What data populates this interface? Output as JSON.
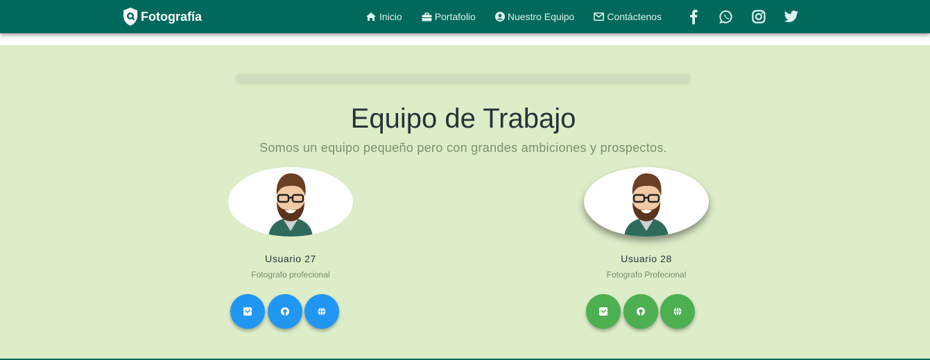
{
  "navbar": {
    "brand": "Fotografía",
    "links": [
      {
        "label": "Inicio",
        "icon": "home-icon"
      },
      {
        "label": "Portafolio",
        "icon": "briefcase-icon"
      },
      {
        "label": "Nuestro Equipo",
        "icon": "user-circle-icon"
      },
      {
        "label": "Contáctenos",
        "icon": "envelope-icon"
      }
    ],
    "social": [
      "facebook-icon",
      "whatsapp-icon",
      "instagram-icon",
      "twitter-icon"
    ],
    "color": "#00695c"
  },
  "team": {
    "title": "Equipo de Trabajo",
    "subtitle": "Somos un equipo pequeño pero con grandes ambiciones y prospectos.",
    "background": "#dcedc8",
    "members": [
      {
        "name": "Usuario 27",
        "role": "Fotografo profecional",
        "button_color": "#2196f3",
        "buttons": [
          "twitter-square-icon",
          "github-icon",
          "globe-icon"
        ]
      },
      {
        "name": "Usuario 28",
        "role": "Fotografo Profecional",
        "button_color": "#4caf50",
        "buttons": [
          "twitter-square-icon",
          "github-icon",
          "globe-icon"
        ]
      }
    ]
  }
}
